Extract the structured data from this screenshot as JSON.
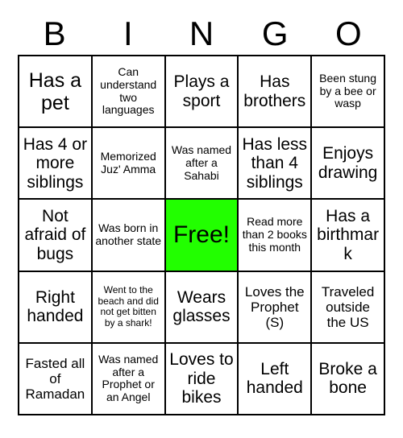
{
  "card": {
    "title": "BINGO",
    "header_letters": [
      "B",
      "I",
      "N",
      "G",
      "O"
    ],
    "free_space_color": "#22ff00",
    "grid_line_color": "#000000",
    "background_color": "#ffffff",
    "columns": 5,
    "rows": 5,
    "cells": [
      {
        "text": "Has a pet",
        "size": "fs-xl",
        "free": false
      },
      {
        "text": "Can understand two languages",
        "size": "fs-sm",
        "free": false
      },
      {
        "text": "Plays a sport",
        "size": "fs-lg",
        "free": false
      },
      {
        "text": "Has brothers",
        "size": "fs-lg",
        "free": false
      },
      {
        "text": "Been stung by a bee or wasp",
        "size": "fs-sm",
        "free": false
      },
      {
        "text": "Has 4 or more siblings",
        "size": "fs-lg",
        "free": false
      },
      {
        "text": "Memorized Juz' Amma",
        "size": "fs-sm",
        "free": false
      },
      {
        "text": "Was named after a Sahabi",
        "size": "fs-sm",
        "free": false
      },
      {
        "text": "Has less than 4 siblings",
        "size": "fs-lg",
        "free": false
      },
      {
        "text": "Enjoys drawing",
        "size": "fs-lg",
        "free": false
      },
      {
        "text": "Not afraid of bugs",
        "size": "fs-lg",
        "free": false
      },
      {
        "text": "Was born in another state",
        "size": "fs-sm",
        "free": false
      },
      {
        "text": "Free!",
        "size": "fs-xl",
        "free": true
      },
      {
        "text": "Read more than 2 books this month",
        "size": "fs-sm",
        "free": false
      },
      {
        "text": "Has a birthmark",
        "size": "fs-lg",
        "free": false
      },
      {
        "text": "Right handed",
        "size": "fs-lg",
        "free": false
      },
      {
        "text": "Went to the beach and did not get bitten by a shark!",
        "size": "fs-xs",
        "free": false
      },
      {
        "text": "Wears glasses",
        "size": "fs-lg",
        "free": false
      },
      {
        "text": "Loves the Prophet (S)",
        "size": "fs-md",
        "free": false
      },
      {
        "text": "Traveled outside the US",
        "size": "fs-md",
        "free": false
      },
      {
        "text": "Fasted all of Ramadan",
        "size": "fs-md",
        "free": false
      },
      {
        "text": "Was named after a Prophet or an Angel",
        "size": "fs-sm",
        "free": false
      },
      {
        "text": "Loves to ride bikes",
        "size": "fs-lg",
        "free": false
      },
      {
        "text": "Left handed",
        "size": "fs-lg",
        "free": false
      },
      {
        "text": "Broke a bone",
        "size": "fs-lg",
        "free": false
      }
    ]
  }
}
